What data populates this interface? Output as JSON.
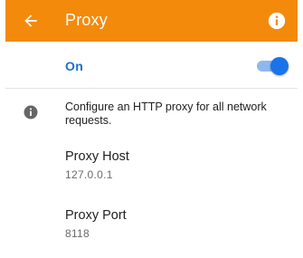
{
  "toolbar": {
    "title": "Proxy",
    "back_icon": "arrow-back-icon",
    "info_icon": "info-icon",
    "background_color": "#f38a0c"
  },
  "master_switch": {
    "label": "On",
    "checked": true,
    "accent_color": "#1a73e8"
  },
  "description": {
    "icon": "info-icon",
    "text": "Configure an HTTP proxy for all network requests."
  },
  "preferences": [
    {
      "title": "Proxy Host",
      "value": "127.0.0.1"
    },
    {
      "title": "Proxy Port",
      "value": "8118"
    }
  ]
}
